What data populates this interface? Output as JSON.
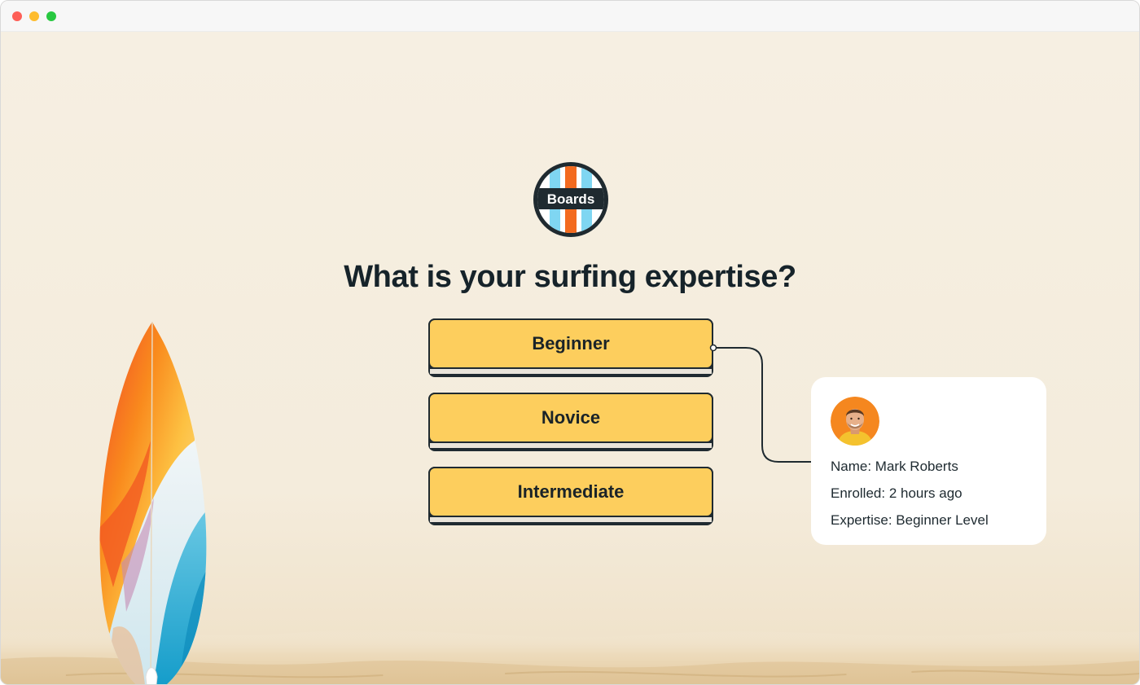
{
  "window": {
    "controls": [
      "close",
      "minimize",
      "maximize"
    ]
  },
  "brand": {
    "logo_text": "Boards",
    "colors": {
      "dark": "#1f2a30",
      "blue": "#7fd6f2",
      "orange": "#f36a1f",
      "option_fill": "#fdce5d",
      "background": "#f6efe2"
    }
  },
  "question": {
    "title": "What is your surfing expertise?"
  },
  "options": [
    {
      "label": "Beginner",
      "selected": true
    },
    {
      "label": "Novice",
      "selected": false
    },
    {
      "label": "Intermediate",
      "selected": false
    }
  ],
  "profile_card": {
    "avatar_icon": "person-avatar",
    "name_line": "Name: Mark Roberts",
    "enrolled_line": "Enrolled: 2 hours ago",
    "expertise_line": "Expertise: Beginner Level"
  },
  "decor": {
    "left_image": "surfboard-illustration",
    "ground": "sand-texture"
  }
}
